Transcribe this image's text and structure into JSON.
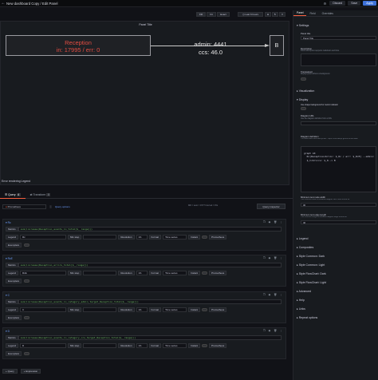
{
  "header": {
    "title": "New dashboard Copy / Edit Panel",
    "discard": "Discard",
    "save": "Save",
    "apply": "Apply"
  },
  "viewbar": {
    "fill": "Fill",
    "fit": "Fit",
    "exact": "Exact",
    "time": "Last 6 hours"
  },
  "panel": {
    "title": "Panel Title",
    "node_a_line1": "Reception",
    "node_a_line2": "in: 17995 / err: 0",
    "node_b": "B",
    "edge_label1": "admin: 4441",
    "edge_label2": "ccs: 46.0",
    "error": "Error rendering Legend"
  },
  "tabs": {
    "query": "Query",
    "query_count": "4",
    "transform": "Transform",
    "transform_count": "0"
  },
  "query_toolbar": {
    "datasource": "Prometheus",
    "options": "Query options",
    "meta": "MD = auto = 1577   Interval = 15s",
    "inspector": "Query inspector"
  },
  "queries": [
    {
      "ref": "Rc",
      "metric": "sum(increase(Reception_events_in_total[$__range]))",
      "legend": "Rc",
      "min_step": "Min step",
      "resolution": "1/1",
      "format": "Time series",
      "instant": "Instant",
      "type": "Prometheus"
    },
    {
      "ref": "RcE",
      "metric": "sum(increase(Reception_errors_total[$__range]))",
      "legend": "RcE",
      "min_step": "Min step",
      "resolution": "1/1",
      "format": "Time series",
      "instant": "Instant",
      "type": "Prometheus"
    },
    {
      "ref": "C",
      "metric": "sum(increase(Reception_events_in_category_admin_target_Reception_total[$__range]))",
      "legend": "C",
      "min_step": "Min step",
      "resolution": "1/1",
      "format": "Time series",
      "instant": "Instant",
      "type": "Prometheus"
    },
    {
      "ref": "D",
      "metric": "sum(increase(Reception_events_in_category_ccs_target_Reception_total[$__range]))",
      "legend": "D",
      "min_step": "Min step",
      "resolution": "1/1",
      "format": "Time series",
      "instant": "Instant",
      "type": "Prometheus"
    }
  ],
  "labels": {
    "metrics": "Metrics",
    "legend": "Legend",
    "resolution": "Resolution",
    "format": "Format",
    "exemplars": "Exemplars"
  },
  "add": {
    "query": "+ Query",
    "expression": "+ Expression"
  },
  "sidebar": {
    "tabs": [
      "Panel",
      "Field",
      "Overrides"
    ],
    "settings": "Settings",
    "panel_title_label": "Panel title",
    "panel_title_value": "Panel Title",
    "description_label": "Description",
    "description_hint": "Panel description supports markdown and links.",
    "transparent_label": "Transparent",
    "transparent_hint": "Display panel without a background.",
    "visualization": "Visualization",
    "display": "Display",
    "shape_bg_label": "Use shape background for metric indicator",
    "diagram_url_label": "Diagram URL",
    "diagram_url_hint": "Use the diagram definition from a URL",
    "definition_label": "Diagram definition",
    "definition_hint": "This area uses Mermaid syntax - https://mermaid-js.github.io/mermaid/",
    "definition_code": "graph LR\n  Rc[Reception<br>in: $_Rc / err: $_RcE] --admin:\n  $_C<br>ccs: $_D--> B",
    "min_node_label": "Minimum text node width",
    "min_node_hint": "The minimum width a rendered diagram text node should be",
    "min_node_value": "30",
    "min_edge_label": "Minimum text edge length",
    "min_edge_hint": "The minimum length a rendered diagram edge should be",
    "min_edge_value": "40",
    "sections": [
      "Legend",
      "Composites",
      "Style Common: Dark",
      "Style Common: Light",
      "Style FlowChart: Dark",
      "Style FlowChart: Light",
      "Advanced",
      "Help",
      "Links",
      "Repeat options"
    ]
  }
}
